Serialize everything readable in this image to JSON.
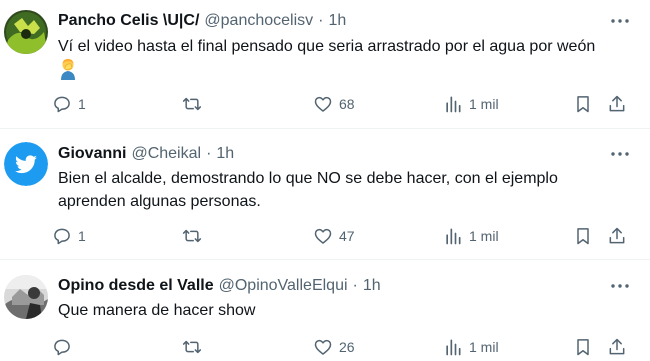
{
  "tweets": [
    {
      "name": "Pancho Celis \\U|C/",
      "handle": "@panchocelisv",
      "separator": "·",
      "time": "1h",
      "text": "Ví el video hasta el final pensado que seria arrastrado por el agua por weón",
      "emoji_icon": "person-facepalming-emoji",
      "replies": "1",
      "retweets": "",
      "likes": "68",
      "views": "1 mil"
    },
    {
      "name": "Giovanni",
      "handle": "@Cheikal",
      "separator": "·",
      "time": "1h",
      "text": "Bien el alcalde, demostrando lo que NO se debe hacer, con el ejemplo aprenden algunas personas.",
      "replies": "1",
      "retweets": "",
      "likes": "47",
      "views": "1 mil"
    },
    {
      "name": "Opino desde el Valle",
      "handle": "@OpinoValleElqui",
      "separator": "·",
      "time": "1h",
      "text": "Que manera de hacer show",
      "replies": "",
      "retweets": "",
      "likes": "26",
      "views": "1 mil"
    }
  ],
  "colors": {
    "text": "#0f1419",
    "secondary": "#536471",
    "divider": "#eff3f4",
    "twitter_blue": "#1d9bf0"
  }
}
